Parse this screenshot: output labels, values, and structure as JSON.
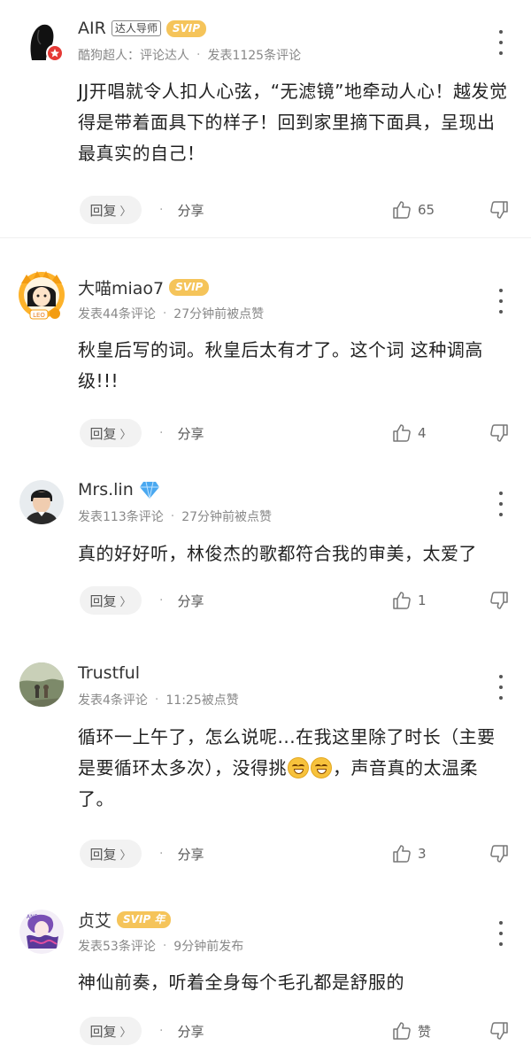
{
  "comments": [
    {
      "name": "AIR",
      "tag": "达人导师",
      "badge": "SVIP",
      "meta1": "酷狗超人：评论达人",
      "meta2": "发表1125条评论",
      "text": "JJ开唱就令人扣人心弦，“无滤镜”地牵动人心！越发觉得是带着面具下的样子！回到家里摘下面具，呈现出最真实的自己！",
      "reply": "回复",
      "share": "分享",
      "likes": "65"
    },
    {
      "name": "大喵miao7",
      "badge": "SVIP",
      "meta1": "发表44条评论",
      "meta2": "27分钟前被点赞",
      "text": "秋皇后写的词。秋皇后太有才了。这个词 这种调高级!!!",
      "reply": "回复",
      "share": "分享",
      "likes": "4"
    },
    {
      "name": "Mrs.lin",
      "meta1": "发表113条评论",
      "meta2": "27分钟前被点赞",
      "text": "真的好好听，林俊杰的歌都符合我的审美，太爱了",
      "reply": "回复",
      "share": "分享",
      "likes": "1"
    },
    {
      "name": "Trustful",
      "meta1": "发表4条评论",
      "meta2": "11:25被点赞",
      "text_a": "循环一上午了，怎么说呢...在我这里除了时长（主要是要循环太多次），没得挑",
      "text_b": "，声音真的太温柔了。",
      "reply": "回复",
      "share": "分享",
      "likes": "3"
    },
    {
      "name": "贞艾",
      "badge": "SVIP 年",
      "meta1": "发表53条评论",
      "meta2": "9分钟前发布",
      "text": "神仙前奏，听着全身每个毛孔都是舒服的",
      "reply": "回复",
      "share": "分享",
      "likes": "赞"
    }
  ],
  "icons": {
    "more": "more-vertical-icon",
    "like": "thumbs-up-icon",
    "dislike": "thumbs-down-icon",
    "chevron": "chevron-right-icon"
  },
  "colors": {
    "svip": "#f5c45a",
    "diamond": "#4aa8f0",
    "vip_badge": "#e53935"
  }
}
